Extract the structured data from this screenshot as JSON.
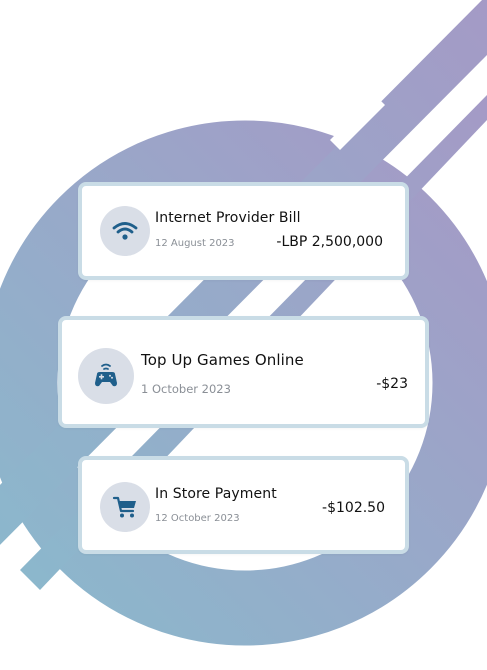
{
  "background": {
    "gradient_start": "#8bb8cc",
    "gradient_end": "#a49ac6"
  },
  "transactions": [
    {
      "title": "Internet Provider Bill",
      "date": "12 August 2023",
      "amount": "-LBP 2,500,000",
      "icon": "wifi-icon"
    },
    {
      "title": "Top Up Games Online",
      "date": "1 October 2023",
      "amount": "-$23",
      "icon": "gamepad-icon"
    },
    {
      "title": "In Store Payment",
      "date": "12 October 2023",
      "amount": "-$102.50",
      "icon": "shopping-cart-icon"
    }
  ],
  "colors": {
    "icon": "#1f5f8b",
    "icon_bg": "#d9dee7",
    "card_border": "#c9dce6"
  }
}
